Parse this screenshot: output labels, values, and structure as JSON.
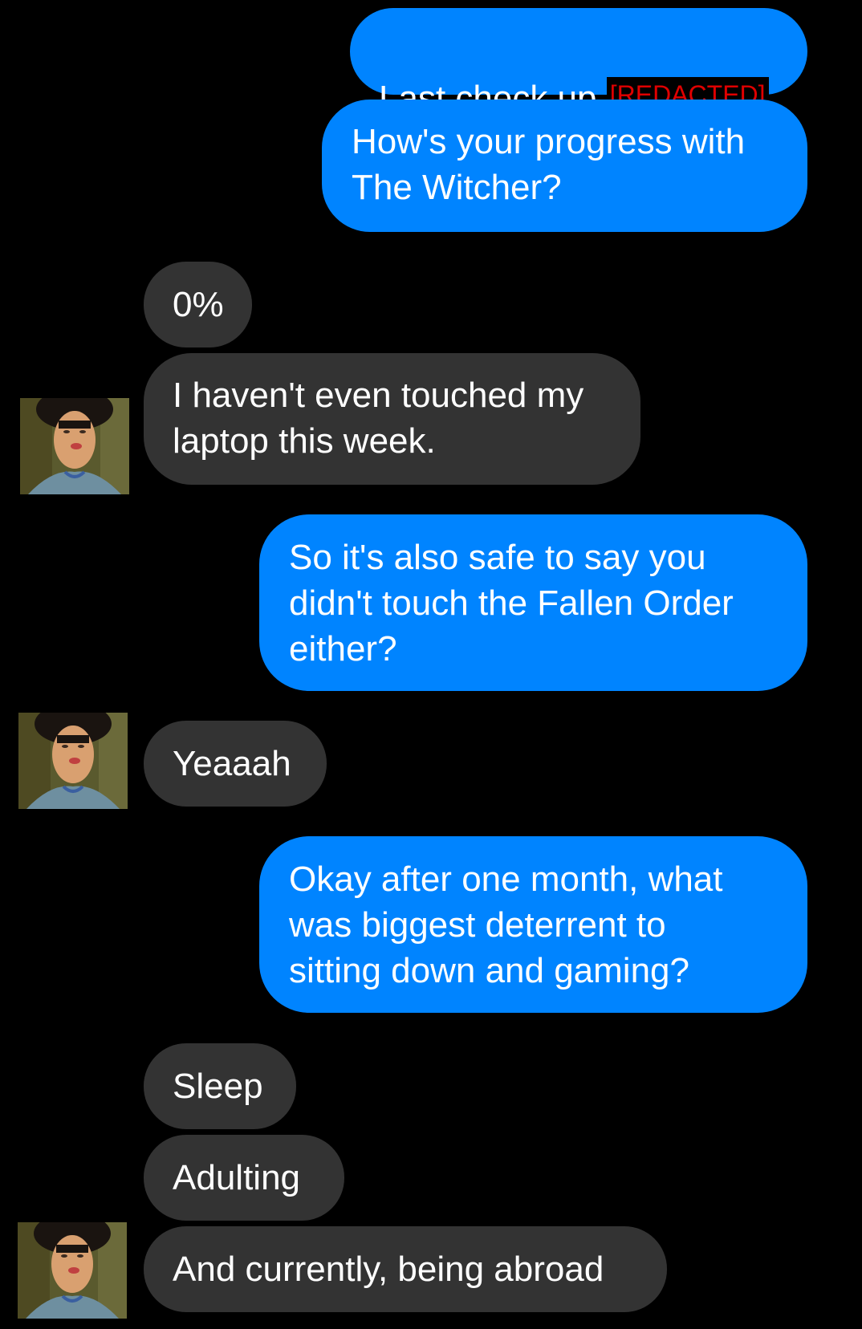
{
  "conversation": {
    "messages": [
      {
        "id": "m1",
        "from": "me",
        "text": "Last check up,",
        "redaction": "[REDACTED]",
        "suffix": "."
      },
      {
        "id": "m2",
        "from": "me",
        "text": "How's your progress with\nThe Witcher?"
      },
      {
        "id": "m3",
        "from": "them",
        "text": "0%"
      },
      {
        "id": "m4",
        "from": "them",
        "text": "I haven't even touched my\nlaptop this week."
      },
      {
        "id": "m5",
        "from": "me",
        "text": "So it's also safe to say you\ndidn't touch the Fallen Order\neither?"
      },
      {
        "id": "m6",
        "from": "them",
        "text": "Yeaaah"
      },
      {
        "id": "m7",
        "from": "me",
        "text": "Okay after one month, what\nwas biggest deterrent to\nsitting down and gaming?"
      },
      {
        "id": "m8",
        "from": "them",
        "text": "Sleep"
      },
      {
        "id": "m9",
        "from": "them",
        "text": "Adulting"
      },
      {
        "id": "m10",
        "from": "them",
        "text": "And currently, being abroad"
      }
    ]
  },
  "colors": {
    "background": "#000000",
    "sent_bubble": "#0084ff",
    "received_bubble": "#333333",
    "text": "#ffffff",
    "redaction_text": "#e00000"
  },
  "avatar": {
    "icon": "contact-photo-avatar"
  }
}
